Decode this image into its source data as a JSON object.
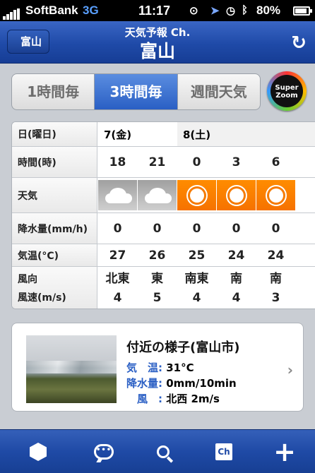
{
  "status": {
    "carrier": "SoftBank",
    "network": "3G",
    "time": "11:17",
    "battery": "80%",
    "icons": [
      "rotation-lock-icon",
      "location-arrow-icon",
      "alarm-clock-icon",
      "bluetooth-icon"
    ]
  },
  "nav": {
    "back_label": "富山",
    "subtitle": "天気予報 Ch.",
    "title": "富山",
    "refresh_icon": "refresh-icon"
  },
  "tabs": [
    {
      "label": "1時間毎",
      "active": false
    },
    {
      "label": "3時間毎",
      "active": true
    },
    {
      "label": "週間天気",
      "active": false
    }
  ],
  "super_zoom": {
    "line1": "Super",
    "line2": "Zoom"
  },
  "forecast": {
    "labels": {
      "date": "日(曜日)",
      "hour": "時間(時)",
      "weather": "天気",
      "precip": "降水量(mm/h)",
      "temp": "気温(°C)",
      "wind_dir": "風向",
      "wind_speed": "風速(m/s)"
    },
    "dates": [
      "7(金)",
      "8(土)"
    ],
    "columns": [
      {
        "hour": "18",
        "weather": "cloudy",
        "precip": "0",
        "temp": "27",
        "wind_dir": "北東",
        "wind_speed": "4"
      },
      {
        "hour": "21",
        "weather": "cloudy",
        "precip": "0",
        "temp": "26",
        "wind_dir": "東",
        "wind_speed": "5"
      },
      {
        "hour": "0",
        "weather": "sunny",
        "precip": "0",
        "temp": "25",
        "wind_dir": "南東",
        "wind_speed": "4"
      },
      {
        "hour": "3",
        "weather": "sunny",
        "precip": "0",
        "temp": "24",
        "wind_dir": "南",
        "wind_speed": "4"
      },
      {
        "hour": "6",
        "weather": "sunny",
        "precip": "0",
        "temp": "24",
        "wind_dir": "南",
        "wind_speed": "3"
      }
    ],
    "colors": {
      "cloudy": "#b4b4b4",
      "sunny": "#f67b00"
    }
  },
  "nearby": {
    "title": "付近の様子(富山市)",
    "temp_label": "気　温:",
    "temp_value": "31°C",
    "precip_label": "降水量:",
    "precip_value": "0mm/10min",
    "wind_label": "　風　:",
    "wind_value": "北西 2m/s"
  },
  "toolbar": {
    "items": [
      "hexagon-icon",
      "chat-bubble-icon",
      "search-icon",
      "channel-icon",
      "add-icon"
    ],
    "channel_text": "Ch"
  },
  "accent": "#1f4aa6"
}
